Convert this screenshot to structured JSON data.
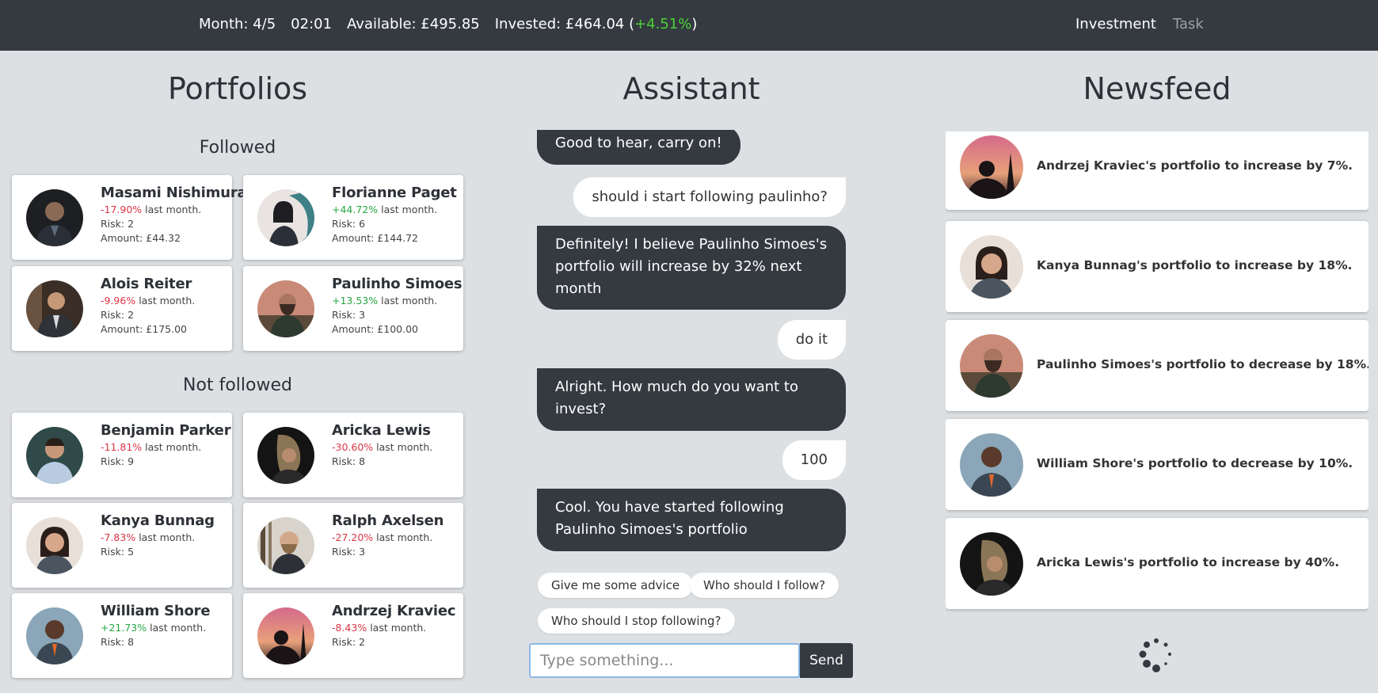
{
  "topbar": {
    "month": "Month: 4/5",
    "time": "02:01",
    "available": "Available: £495.85",
    "invested_prefix": "Invested: £464.04 (",
    "invested_change": "+4.51%",
    "invested_suffix": ")",
    "nav": {
      "investment": "Investment",
      "task": "Task"
    }
  },
  "portfolios": {
    "title": "Portfolios",
    "followed_label": "Followed",
    "not_followed_label": "Not followed",
    "followed": [
      {
        "name": "Masami Nishimura",
        "change": "-17.90%",
        "change_suffix": " last month.",
        "risk": "Risk: 2",
        "amount": "Amount: £44.32"
      },
      {
        "name": "Florianne Paget",
        "change": "+44.72%",
        "change_suffix": " last month.",
        "risk": "Risk: 6",
        "amount": "Amount: £144.72"
      },
      {
        "name": "Alois Reiter",
        "change": "-9.96%",
        "change_suffix": " last month.",
        "risk": "Risk: 2",
        "amount": "Amount: £175.00"
      },
      {
        "name": "Paulinho Simoes",
        "change": "+13.53%",
        "change_suffix": " last month.",
        "risk": "Risk: 3",
        "amount": "Amount: £100.00"
      }
    ],
    "not_followed": [
      {
        "name": "Benjamin Parker",
        "change": "-11.81%",
        "change_suffix": " last month.",
        "risk": "Risk: 9"
      },
      {
        "name": "Aricka Lewis",
        "change": "-30.60%",
        "change_suffix": " last month.",
        "risk": "Risk: 8"
      },
      {
        "name": "Kanya Bunnag",
        "change": "-7.83%",
        "change_suffix": " last month.",
        "risk": "Risk: 5"
      },
      {
        "name": "Ralph Axelsen",
        "change": "-27.20%",
        "change_suffix": " last month.",
        "risk": "Risk: 3"
      },
      {
        "name": "William Shore",
        "change": "+21.73%",
        "change_suffix": " last month.",
        "risk": "Risk: 8"
      },
      {
        "name": "Andrzej Kraviec",
        "change": "-8.43%",
        "change_suffix": " last month.",
        "risk": "Risk: 2"
      }
    ]
  },
  "assistant": {
    "title": "Assistant",
    "messages": [
      {
        "from": "bot",
        "text": "Good to hear, carry on!"
      },
      {
        "from": "user",
        "text": "should i start following paulinho?"
      },
      {
        "from": "bot",
        "lines": [
          "Definitely! I believe Paulinho Simoes's",
          "portfolio will increase by 32% next",
          "month"
        ]
      },
      {
        "from": "user",
        "text": "do it"
      },
      {
        "from": "bot",
        "lines": [
          "Alright. How much do you want to",
          "invest?"
        ]
      },
      {
        "from": "user",
        "text": "100"
      },
      {
        "from": "bot",
        "lines": [
          "Cool. You have started following",
          "Paulinho Simoes's portfolio"
        ]
      }
    ],
    "suggestions": [
      "Give me some advice",
      "Who should I follow?",
      "Who should I stop following?"
    ],
    "input_placeholder": "Type something...",
    "send_label": "Send"
  },
  "newsfeed": {
    "title": "Newsfeed",
    "items": [
      {
        "text": "Andrzej Kraviec's portfolio to increase by 7%."
      },
      {
        "text": "Kanya Bunnag's portfolio to increase by 18%."
      },
      {
        "text": "Paulinho Simoes's portfolio to decrease by 18%."
      },
      {
        "text": "William Shore's portfolio to decrease by 10%."
      },
      {
        "text": "Aricka Lewis's portfolio to increase by 40%."
      }
    ]
  },
  "colors": {
    "topbar": "#343a40",
    "background": "#dde0e3",
    "negative": "#dc3545",
    "positive": "#28a745",
    "bot_bubble": "#343a40"
  }
}
